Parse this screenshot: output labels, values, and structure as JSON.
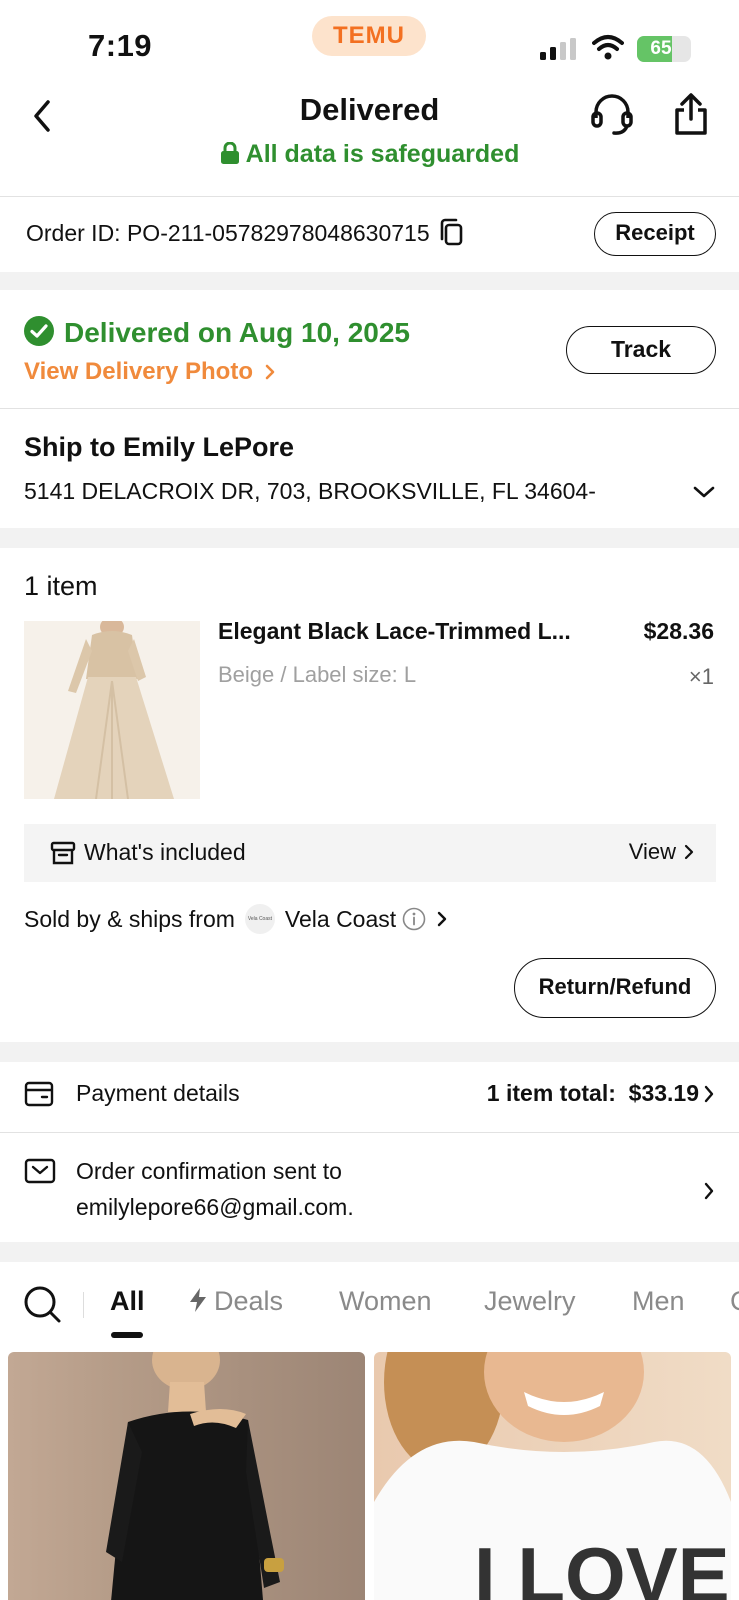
{
  "status_bar": {
    "time": "7:19",
    "app_pill": "TEMU",
    "battery": "65",
    "battery_level_percent": 65
  },
  "header": {
    "title": "Delivered",
    "subtitle": "All data is safeguarded"
  },
  "order": {
    "id_label": "Order ID: PO-211-05782978048630715",
    "receipt_label": "Receipt"
  },
  "delivery": {
    "status": "Delivered on Aug 10, 2025",
    "photo_link": "View Delivery Photo",
    "track_label": "Track"
  },
  "shipping": {
    "name_line": "Ship to Emily LePore",
    "address": "5141 DELACROIX DR, 703, BROOKSVILLE, FL 34604-"
  },
  "items": {
    "count_label": "1 item",
    "list": [
      {
        "name": "Elegant Black Lace-Trimmed L...",
        "price": "$28.36",
        "variant": "Beige / Label size: L",
        "qty": "×1"
      }
    ],
    "included_label": "What's included",
    "included_view": "View",
    "sold_by_label": "Sold by & ships from",
    "store_name": "Vela Coast",
    "store_logo_text": "Vela Coast",
    "refund_label": "Return/Refund"
  },
  "payment": {
    "label": "Payment details",
    "total": "1 item total:  $33.19"
  },
  "confirmation": {
    "line1": "Order confirmation sent to",
    "line2": "emilylepore66@gmail.com."
  },
  "tabs": {
    "items": [
      "All",
      "Deals",
      "Women",
      "Jewelry",
      "Men",
      "C"
    ],
    "active": "All"
  },
  "recommendations": {
    "card2_text": "I LOVE"
  },
  "colors": {
    "accent_orange": "#f08a3c",
    "success_green": "#2f8f2f",
    "brand_orange": "#f37021"
  }
}
